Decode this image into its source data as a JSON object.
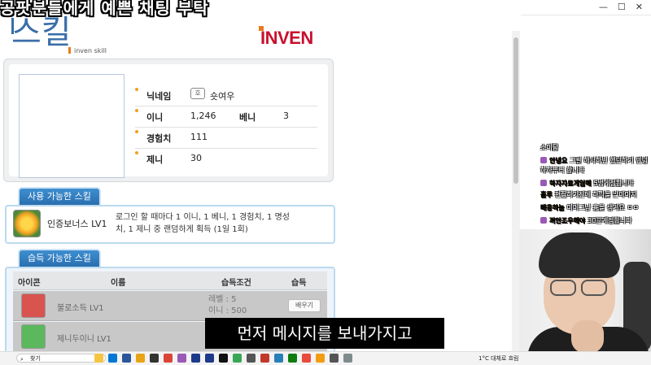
{
  "overlay": {
    "title": "공팟분들에게 예쁜 채팅 부탁"
  },
  "window": {
    "min": "—",
    "max": "☐",
    "close": "✕"
  },
  "header": {
    "logo_text": "스킬",
    "logo_sub": "inven skill",
    "brand": "INVEN"
  },
  "profile": {
    "nick_label": "닉네임",
    "nick_icon": "호",
    "nick_value": "숏여우",
    "ini_label": "이니",
    "ini_value": "1,246",
    "beni_label": "베니",
    "beni_value": "3",
    "exp_label": "경험치",
    "exp_value": "111",
    "jeni_label": "제니",
    "jeni_value": "30"
  },
  "usable": {
    "tab": "사용 가능한 스킬",
    "skill_name": "인증보너스 LV1",
    "skill_desc": "로그인 할 때마다 1 이니, 1 베니, 1 경험치, 1 명성치, 1 제니 중 랜덤하게 획득 (1일 1회)"
  },
  "learn": {
    "tab": "습득 가능한 스킬",
    "headers": {
      "icon": "아이콘",
      "name": "이름",
      "cond": "습득조건",
      "learn": "습득"
    },
    "rows": [
      {
        "name": "불로소득 LV1",
        "cond1": "레벨 : 5",
        "cond2": "이니 : 500",
        "button": "배우기",
        "icon_color": "#d9534f"
      },
      {
        "name": "제니두이니 LV1",
        "cond1": "",
        "cond2": "",
        "button": "",
        "icon_color": "#5cb85c"
      }
    ]
  },
  "chat": {
    "lines": [
      {
        "nick": "",
        "msg": "소이탐"
      },
      {
        "nick": "안녕요",
        "msg": "그팔 해서하빈 했던하기 안녕"
      },
      {
        "nick": "",
        "msg": "하하부터 합니다"
      },
      {
        "nick": "하자자료게임해",
        "msg": "5법게정됩니다"
      },
      {
        "nick": "홀루",
        "msg": "편집하기전에 하락을 받아야지"
      },
      {
        "nick": "매웅하늘",
        "msg": "이어그냥 흥을 생겨요 ㅇㅇ"
      },
      {
        "nick": "끼안조우해야",
        "msg": "30분계정합니다"
      }
    ]
  },
  "subtitle": "먼저 메시지를 보내가지고",
  "taskbar": {
    "search": "찾기",
    "weather": "1°C 대체로 흐림"
  }
}
